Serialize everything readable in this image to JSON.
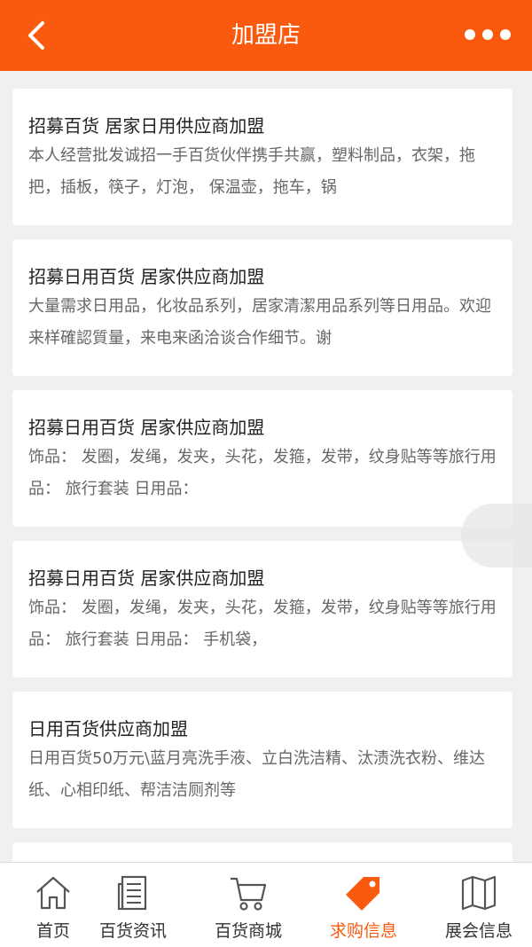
{
  "header": {
    "title": "加盟店"
  },
  "cards": [
    {
      "title": "招募百货 居家日用供应商加盟",
      "desc": "本人经营批发诚招一手百货伙伴携手共赢，塑料制品，衣架，拖把，插板，筷子，灯泡， 保温壶，拖车，锅"
    },
    {
      "title": "招募日用百货 居家供应商加盟",
      "desc": "大量需求日用品，化妆品系列，居家清潔用品系列等日用品。欢迎来样確認質量，来电来函洽谈合作细节。谢"
    },
    {
      "title": "招募日用百货 居家供应商加盟",
      "desc": "饰品： 发圈，发绳，发夹，头花，发箍，发带，纹身贴等等旅行用品： 旅行套装 日用品："
    },
    {
      "title": "招募日用百货 居家供应商加盟",
      "desc": "饰品： 发圈，发绳，发夹，头花，发箍，发带，纹身贴等等旅行用品： 旅行套装 日用品： 手机袋，"
    },
    {
      "title": "日用百货供应商加盟",
      "desc": "日用百货50万元\\蓝月亮洗手液、立白洗洁精、汰渍洗衣粉、维达纸、心相印纸、帮洁洁厕剂等"
    }
  ],
  "tabs": [
    {
      "label": "首页",
      "icon": "home-icon"
    },
    {
      "label": "百货资讯",
      "icon": "news-icon"
    },
    {
      "label": "百货商城",
      "icon": "cart-icon"
    },
    {
      "label": "求购信息",
      "icon": "tag-icon"
    },
    {
      "label": "展会信息",
      "icon": "map-icon"
    }
  ],
  "colors": {
    "accent": "#f95a0e",
    "background": "#f0f0f0"
  }
}
